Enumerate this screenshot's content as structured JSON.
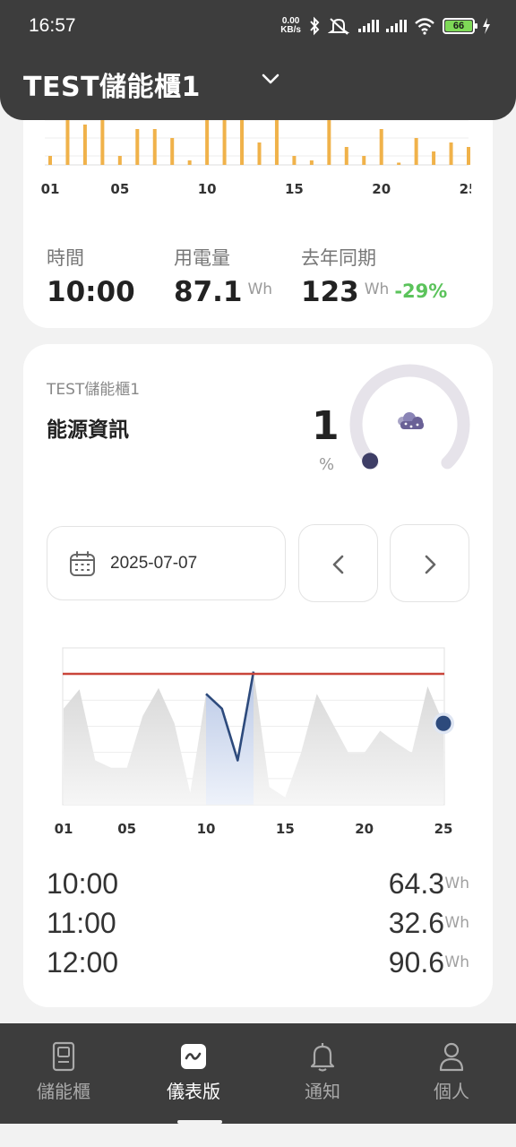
{
  "status_bar": {
    "time": "16:57",
    "net_speed_value": "0.00",
    "net_speed_unit": "KB/s",
    "battery": "66",
    "icons": [
      "bluetooth-icon",
      "mute-icon",
      "signal-icon",
      "signal-icon",
      "wifi-icon",
      "battery-icon",
      "charging-icon"
    ]
  },
  "header": {
    "title": "TEST儲能櫃1",
    "dropdown_icon": "chevron-down-icon"
  },
  "usage_card": {
    "bar_chart": {
      "type": "bar",
      "x_tick_labels": [
        "01",
        "05",
        "10",
        "15",
        "20",
        "25"
      ],
      "bar_color": "#f0b24a",
      "values": [
        2,
        12,
        9,
        11,
        2,
        8,
        8,
        6,
        1,
        10,
        11,
        11,
        5,
        10,
        2,
        1,
        11,
        4,
        2,
        8,
        0.5,
        6,
        3,
        5,
        4
      ]
    },
    "stats": [
      {
        "label": "時間",
        "value": "10:00",
        "unit": ""
      },
      {
        "label": "用電量",
        "value": "87.1",
        "unit": "Wh"
      },
      {
        "label": "去年同期",
        "value": "123",
        "unit": "Wh",
        "delta": "-29%"
      }
    ]
  },
  "energy_card": {
    "device_name": "TEST儲能櫃1",
    "title": "能源資訊",
    "gauge_value": "1",
    "gauge_unit": "%",
    "weather_icon": "cloudy-icon",
    "gauge_fraction": 0.01,
    "date": "2025-07-07",
    "prev_icon": "chevron-left-icon",
    "next_icon": "chevron-right-icon",
    "line_chart": {
      "type": "area",
      "x_tick_labels": [
        "01",
        "05",
        "10",
        "15",
        "20",
        "25"
      ],
      "threshold_color": "#c9453a",
      "line_color": "#2d4a7c",
      "values": [
        65,
        78,
        30,
        25,
        25,
        60,
        79,
        55,
        8,
        75,
        65,
        30,
        90,
        12,
        5,
        35,
        75,
        55,
        35,
        35,
        50,
        42,
        35,
        80,
        55
      ],
      "highlight_range": [
        10,
        13
      ]
    },
    "readings": [
      {
        "time": "10:00",
        "value": "64.3",
        "unit": "Wh"
      },
      {
        "time": "11:00",
        "value": "32.6",
        "unit": "Wh"
      },
      {
        "time": "12:00",
        "value": "90.6",
        "unit": "Wh"
      }
    ]
  },
  "bottom_nav": {
    "items": [
      {
        "label": "儲能櫃",
        "icon": "cabinet-icon",
        "active": false
      },
      {
        "label": "儀表版",
        "icon": "dashboard-icon",
        "active": true
      },
      {
        "label": "通知",
        "icon": "bell-icon",
        "active": false
      },
      {
        "label": "個人",
        "icon": "person-icon",
        "active": false
      }
    ]
  }
}
